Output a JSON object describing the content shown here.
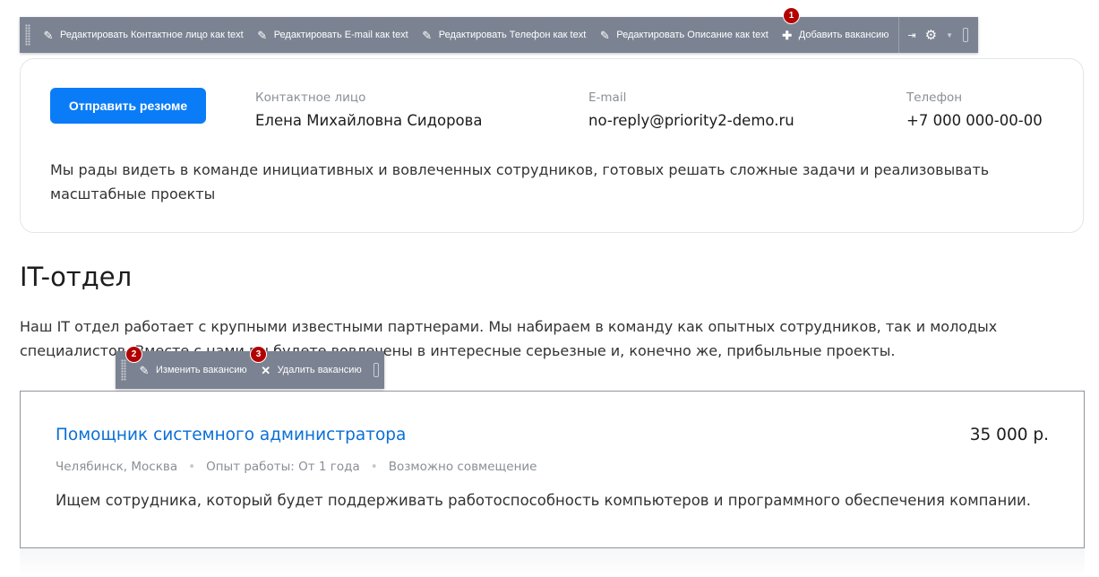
{
  "top_toolbar": {
    "items": [
      {
        "label": "Редактировать Контактное лицо как text",
        "icon": "pencil-icon"
      },
      {
        "label": "Редактировать E-mail как text",
        "icon": "pencil-icon"
      },
      {
        "label": "Редактировать Телефон как text",
        "icon": "pencil-icon"
      },
      {
        "label": "Редактировать Описание как text",
        "icon": "pencil-icon"
      },
      {
        "label": "Добавить вакансию",
        "icon": "plus-icon"
      }
    ],
    "badge": "1"
  },
  "contact": {
    "button_label": "Отправить резюме",
    "person_label": "Контактное лицо",
    "person_value": "Елена Михайловна Сидорова",
    "email_label": "E-mail",
    "email_value": "no-reply@priority2-demo.ru",
    "phone_label": "Телефон",
    "phone_value": "+7 000 000-00-00",
    "description": "Мы рады видеть в команде инициативных и вовлеченных сотрудников, готовых решать сложные задачи и реализовывать масштабные проекты"
  },
  "section": {
    "title": "IT-отдел",
    "description": "Наш IT отдел работает с крупными известными партнерами. Мы набираем в команду как опытных сотрудников, так и молодых специалистов. Вместе с нами вы будете вовлечены в интересные серьезные и, конечно же, прибыльные проекты."
  },
  "vacancy_toolbar": {
    "edit_label": "Изменить вакансию",
    "edit_badge": "2",
    "delete_label": "Удалить вакансию",
    "delete_badge": "3"
  },
  "vacancy": {
    "title": "Помощник системного администратора",
    "salary": "35 000 р.",
    "location": "Челябинск, Москва",
    "experience": "Опыт работы: От 1 года",
    "combination": "Возможно совмещение",
    "description": "Ищем сотрудника, который будет поддерживать работоспособность компьютеров и программного обеспечения компании."
  }
}
